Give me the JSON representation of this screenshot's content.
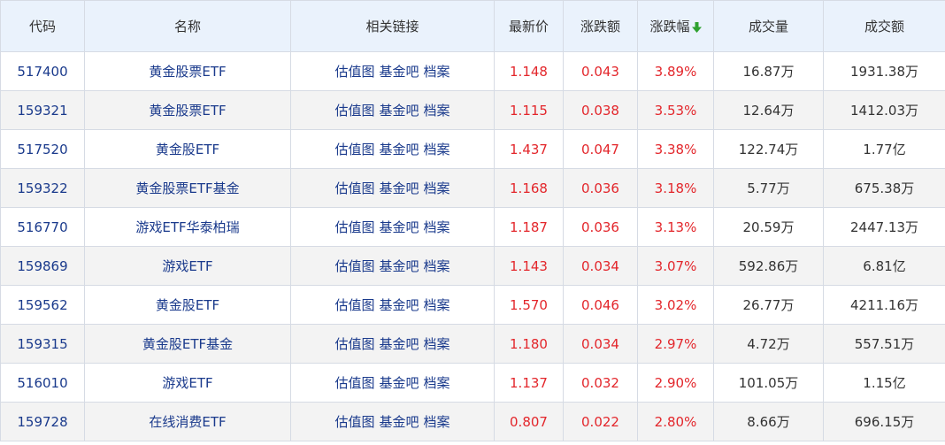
{
  "header": {
    "code": "代码",
    "name": "名称",
    "links": "相关链接",
    "price": "最新价",
    "change": "涨跌额",
    "change_pct": "涨跌幅",
    "volume": "成交量",
    "amount": "成交额"
  },
  "sort_icon_color": "#2fa12f",
  "link_labels": [
    "估值图",
    "基金吧",
    "档案"
  ],
  "rows": [
    {
      "code": "517400",
      "name": "黄金股票ETF",
      "price": "1.148",
      "change": "0.043",
      "pct": "3.89%",
      "volume": "16.87万",
      "amount": "1931.38万"
    },
    {
      "code": "159321",
      "name": "黄金股票ETF",
      "price": "1.115",
      "change": "0.038",
      "pct": "3.53%",
      "volume": "12.64万",
      "amount": "1412.03万"
    },
    {
      "code": "517520",
      "name": "黄金股ETF",
      "price": "1.437",
      "change": "0.047",
      "pct": "3.38%",
      "volume": "122.74万",
      "amount": "1.77亿"
    },
    {
      "code": "159322",
      "name": "黄金股票ETF基金",
      "price": "1.168",
      "change": "0.036",
      "pct": "3.18%",
      "volume": "5.77万",
      "amount": "675.38万"
    },
    {
      "code": "516770",
      "name": "游戏ETF华泰柏瑞",
      "price": "1.187",
      "change": "0.036",
      "pct": "3.13%",
      "volume": "20.59万",
      "amount": "2447.13万"
    },
    {
      "code": "159869",
      "name": "游戏ETF",
      "price": "1.143",
      "change": "0.034",
      "pct": "3.07%",
      "volume": "592.86万",
      "amount": "6.81亿"
    },
    {
      "code": "159562",
      "name": "黄金股ETF",
      "price": "1.570",
      "change": "0.046",
      "pct": "3.02%",
      "volume": "26.77万",
      "amount": "4211.16万"
    },
    {
      "code": "159315",
      "name": "黄金股ETF基金",
      "price": "1.180",
      "change": "0.034",
      "pct": "2.97%",
      "volume": "4.72万",
      "amount": "557.51万"
    },
    {
      "code": "516010",
      "name": "游戏ETF",
      "price": "1.137",
      "change": "0.032",
      "pct": "2.90%",
      "volume": "101.05万",
      "amount": "1.15亿"
    },
    {
      "code": "159728",
      "name": "在线消费ETF",
      "price": "0.807",
      "change": "0.022",
      "pct": "2.80%",
      "volume": "8.66万",
      "amount": "696.15万"
    }
  ]
}
